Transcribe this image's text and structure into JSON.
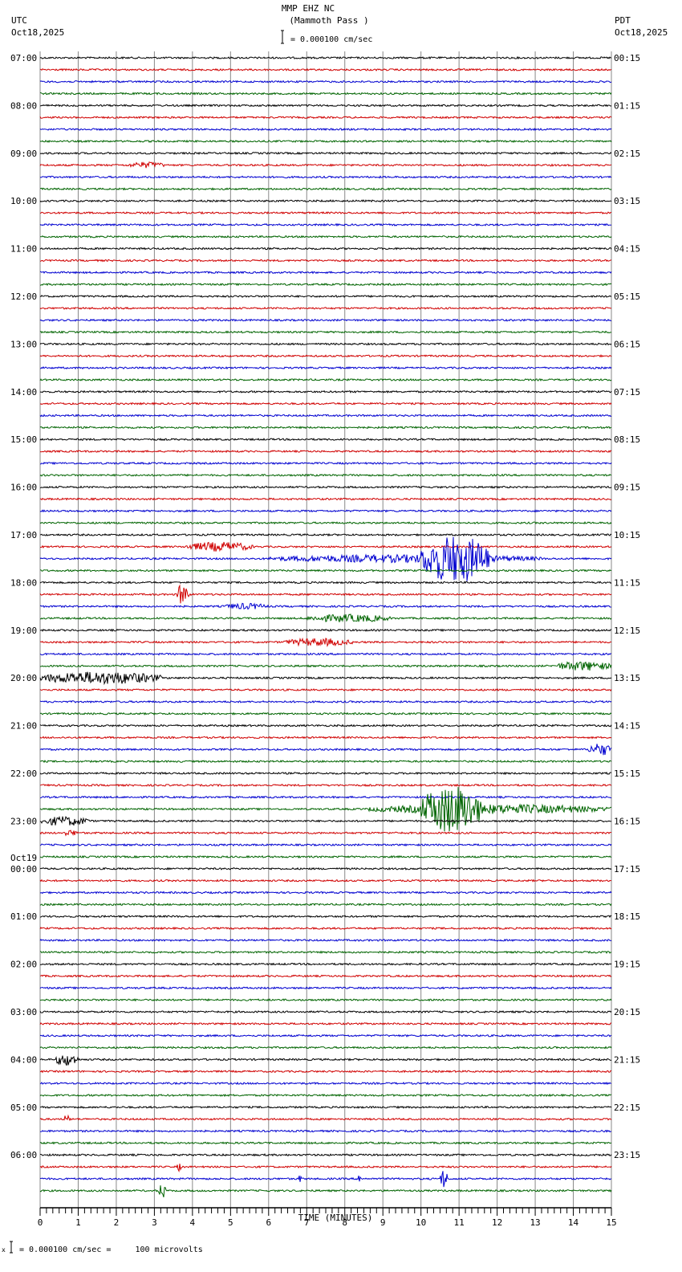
{
  "header": {
    "title": "MMP EHZ NC",
    "subtitle": "(Mammoth Pass )",
    "scale": "= 0.000100 cm/sec",
    "left_tz": "UTC",
    "left_date": "Oct18,2025",
    "right_tz": "PDT",
    "right_date": "Oct18,2025"
  },
  "footer": {
    "scale_note": "= 0.000100 cm/sec =     100 microvolts",
    "mark": "x"
  },
  "chart_data": {
    "type": "line",
    "title": "MMP EHZ NC (Mammoth Pass )",
    "xlabel": "TIME (MINUTES)",
    "xlim": [
      0,
      15
    ],
    "x_ticks": [
      "0",
      "1",
      "2",
      "3",
      "4",
      "5",
      "6",
      "7",
      "8",
      "9",
      "10",
      "11",
      "12",
      "13",
      "14",
      "15"
    ],
    "traces_per_hour": 4,
    "trace_colors": [
      "#000000",
      "#d00000",
      "#0000d0",
      "#006400"
    ],
    "left_labels": [
      "07:00",
      "08:00",
      "09:00",
      "10:00",
      "11:00",
      "12:00",
      "13:00",
      "14:00",
      "15:00",
      "16:00",
      "17:00",
      "18:00",
      "19:00",
      "20:00",
      "21:00",
      "22:00",
      "23:00",
      "00:00",
      "01:00",
      "02:00",
      "03:00",
      "04:00",
      "05:00",
      "06:00"
    ],
    "date_change_label": {
      "before_hour_index": 17,
      "text": "Oct19"
    },
    "right_labels": [
      "00:15",
      "01:15",
      "02:15",
      "03:15",
      "04:15",
      "05:15",
      "06:15",
      "07:15",
      "08:15",
      "09:15",
      "10:15",
      "11:15",
      "12:15",
      "13:15",
      "14:15",
      "15:15",
      "16:15",
      "17:15",
      "18:15",
      "19:15",
      "20:15",
      "21:15",
      "22:15",
      "23:15"
    ],
    "events": [
      {
        "trace": 9,
        "start": 2.3,
        "end": 3.3,
        "amp": 4
      },
      {
        "trace": 41,
        "start": 3.8,
        "end": 5.6,
        "amp": 6
      },
      {
        "trace": 42,
        "start": 6.0,
        "end": 13.2,
        "amp": 5
      },
      {
        "trace": 42,
        "start": 10.0,
        "end": 11.8,
        "amp": 30
      },
      {
        "trace": 45,
        "start": 3.6,
        "end": 3.9,
        "amp": 14
      },
      {
        "trace": 46,
        "start": 4.8,
        "end": 6.0,
        "amp": 4
      },
      {
        "trace": 47,
        "start": 7.0,
        "end": 9.2,
        "amp": 5
      },
      {
        "trace": 49,
        "start": 6.4,
        "end": 8.2,
        "amp": 5
      },
      {
        "trace": 51,
        "start": 13.5,
        "end": 15.0,
        "amp": 6
      },
      {
        "trace": 52,
        "start": 0.0,
        "end": 3.2,
        "amp": 8
      },
      {
        "trace": 58,
        "start": 14.4,
        "end": 15.0,
        "amp": 8
      },
      {
        "trace": 63,
        "start": 8.6,
        "end": 15.0,
        "amp": 6
      },
      {
        "trace": 63,
        "start": 10.0,
        "end": 11.6,
        "amp": 30
      },
      {
        "trace": 64,
        "start": 0.0,
        "end": 1.3,
        "amp": 6
      },
      {
        "trace": 65,
        "start": 0.6,
        "end": 1.0,
        "amp": 4
      },
      {
        "trace": 84,
        "start": 0.4,
        "end": 1.0,
        "amp": 8
      },
      {
        "trace": 89,
        "start": 0.6,
        "end": 0.8,
        "amp": 5
      },
      {
        "trace": 93,
        "start": 3.6,
        "end": 3.7,
        "amp": 6
      },
      {
        "trace": 94,
        "start": 10.5,
        "end": 10.7,
        "amp": 12
      },
      {
        "trace": 94,
        "start": 8.35,
        "end": 8.45,
        "amp": 8
      },
      {
        "trace": 94,
        "start": 6.75,
        "end": 6.85,
        "amp": 6
      },
      {
        "trace": 95,
        "start": 3.1,
        "end": 3.3,
        "amp": 10
      }
    ]
  }
}
